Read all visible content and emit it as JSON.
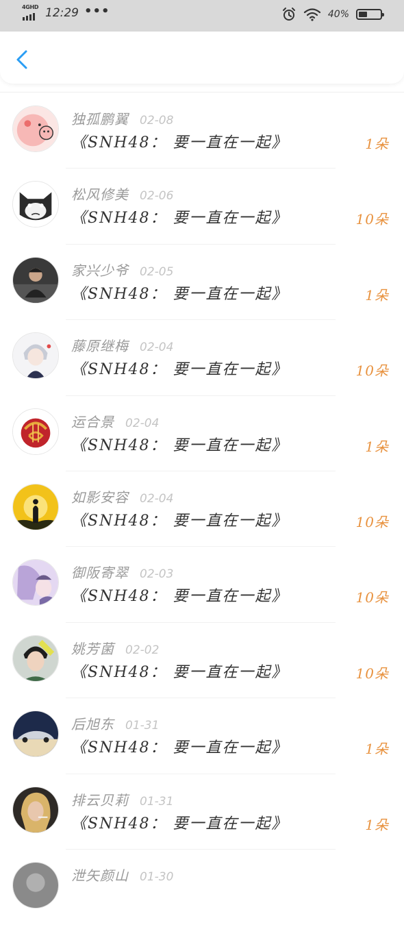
{
  "status_bar": {
    "network": "4GHD",
    "time": "12:29",
    "dots": "•••",
    "battery": "40%"
  },
  "nav": {
    "back_icon": "chevron-left-icon",
    "accent_color": "#2a9df4"
  },
  "colors": {
    "count": "#e8923f",
    "name": "#9a9a9a",
    "date": "#c4c4c4",
    "title": "#333333"
  },
  "list": {
    "items": [
      {
        "name": "独孤鹏翼",
        "date": "02-08",
        "title": "《SNH48： 要一直在一起》",
        "count": "1朵",
        "avatar": "pink-pig-avatar"
      },
      {
        "name": "松风修美",
        "date": "02-06",
        "title": "《SNH48： 要一直在一起》",
        "count": "10朵",
        "avatar": "grumpy-cat-avatar"
      },
      {
        "name": "家兴少爷",
        "date": "02-05",
        "title": "《SNH48： 要一直在一起》",
        "count": "1朵",
        "avatar": "young-man-photo-avatar"
      },
      {
        "name": "藤原继梅",
        "date": "02-04",
        "title": "《SNH48： 要一直在一起》",
        "count": "10朵",
        "avatar": "anime-boy-avatar"
      },
      {
        "name": "运合景",
        "date": "02-04",
        "title": "《SNH48： 要一直在一起》",
        "count": "1朵",
        "avatar": "fortune-character-avatar"
      },
      {
        "name": "如影安容",
        "date": "02-04",
        "title": "《SNH48： 要一直在一起》",
        "count": "10朵",
        "avatar": "sunset-silhouette-avatar"
      },
      {
        "name": "御阪寄翠",
        "date": "02-03",
        "title": "《SNH48： 要一直在一起》",
        "count": "10朵",
        "avatar": "anime-couple-avatar"
      },
      {
        "name": "姚芳菌",
        "date": "02-02",
        "title": "《SNH48： 要一直在一起》",
        "count": "10朵",
        "avatar": "portrait-photo-avatar"
      },
      {
        "name": "后旭东",
        "date": "01-31",
        "title": "《SNH48： 要一直在一起》",
        "count": "1朵",
        "avatar": "sports-car-avatar"
      },
      {
        "name": "排云贝莉",
        "date": "01-31",
        "title": "《SNH48： 要一直在一起》",
        "count": "1朵",
        "avatar": "woman-smoking-avatar"
      },
      {
        "name": "泄矢颜山",
        "date": "01-30",
        "title": "",
        "count": "",
        "avatar": "gray-photo-avatar"
      }
    ]
  }
}
